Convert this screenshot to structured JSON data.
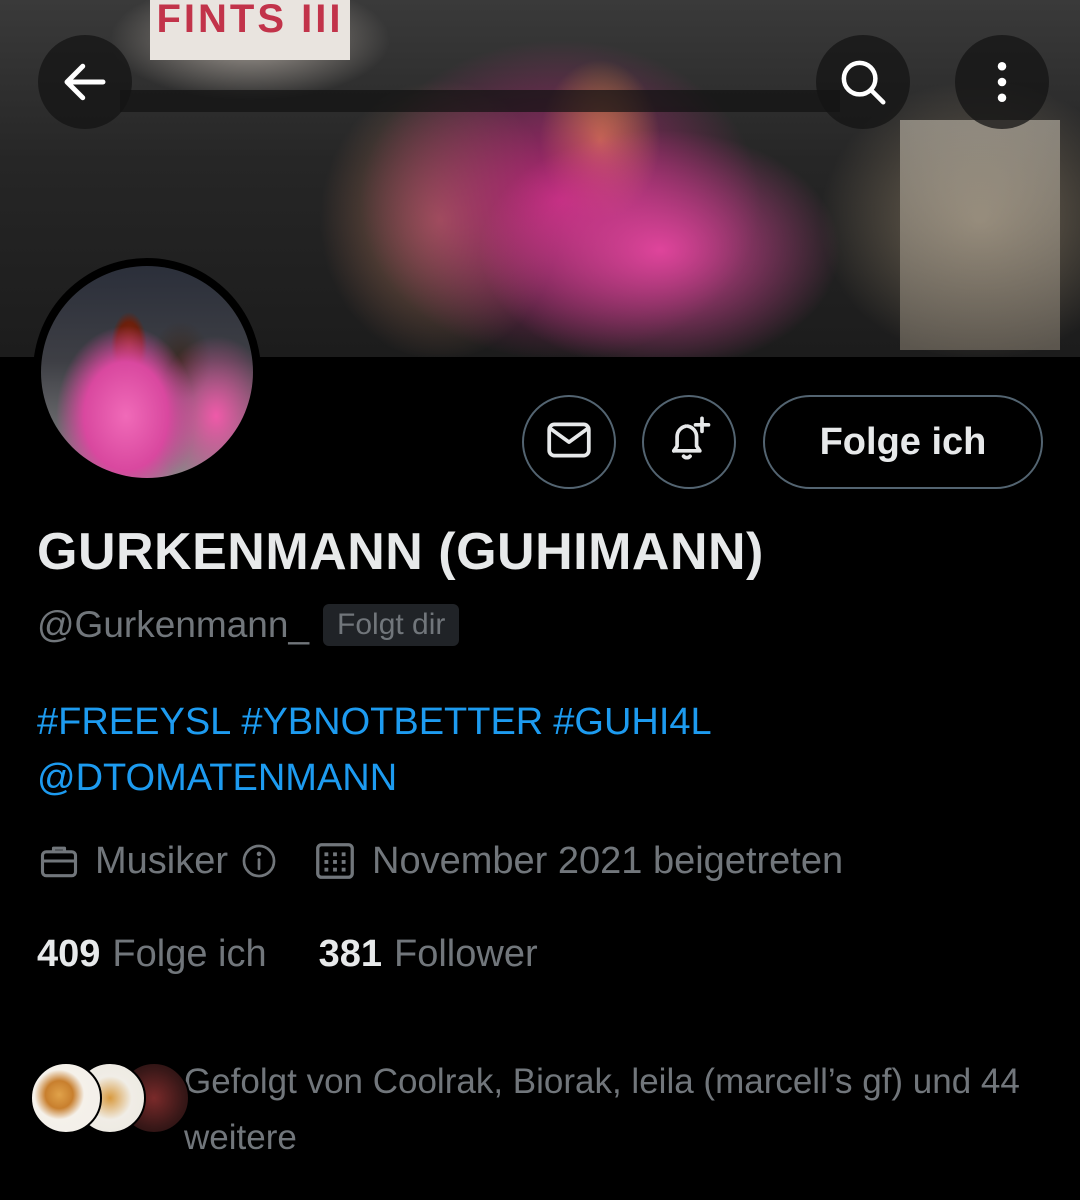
{
  "banner": {
    "sign_text": "FINTS III"
  },
  "header": {
    "back_icon": "arrow-left-icon",
    "search_icon": "search-icon",
    "more_icon": "more-vertical-icon"
  },
  "actions": {
    "message_icon": "envelope-icon",
    "notify_icon": "bell-plus-icon",
    "follow_label": "Folge ich"
  },
  "profile": {
    "display_name": "GURKENMANN (GUHIMANN)",
    "handle": "@Gurkenmann_",
    "follows_you_badge": "Folgt dir",
    "bio": {
      "hashtags": [
        "#FREEYSL",
        "#YBNOTBETTER",
        "#GUHI4L"
      ],
      "mention": "@DTOMATENMANN"
    },
    "category": "Musiker",
    "joined": "November 2021 beigetreten"
  },
  "stats": {
    "following_count": "409",
    "following_label": "Folge ich",
    "followers_count": "381",
    "followers_label": "Follower"
  },
  "followed_by": {
    "text": "Gefolgt von Coolrak, Biorak, leila (marcell’s gf) und 44 weitere"
  },
  "colors": {
    "background": "#000000",
    "link": "#1d9bf0",
    "muted": "#71767b",
    "border": "#536471",
    "text": "#e7e9ea"
  }
}
